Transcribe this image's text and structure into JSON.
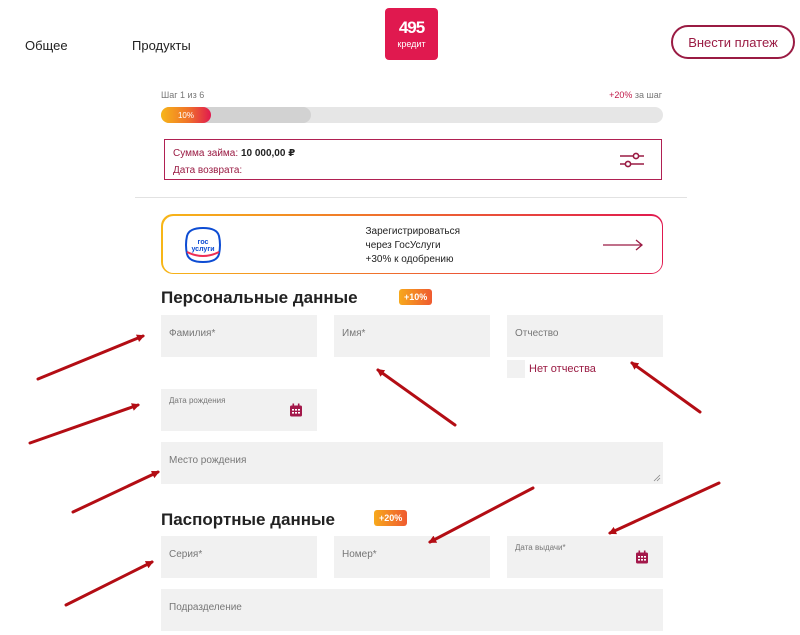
{
  "nav": {
    "general": "Общее",
    "products": "Продукты"
  },
  "logo": {
    "number": "495",
    "word": "кредит"
  },
  "header": {
    "pay_button": "Внести платеж"
  },
  "progress": {
    "step_label": "Шаг 1 из 6",
    "bonus_pct": "+20%",
    "bonus_suffix": " за шаг",
    "fill_label": "10%",
    "fill_fraction": 0.1
  },
  "summary": {
    "amount_label": "Сумма займа: ",
    "amount_value": "10 000,00 ₽",
    "return_label": "Дата возврата:"
  },
  "gosuslugi": {
    "logo_line1": "гос",
    "logo_line2": "услуги",
    "line1": "Зарегистрироваться",
    "line2": "через ГосУслуги",
    "line3": "+30% к одобрению"
  },
  "personal": {
    "title": "Персональные данные",
    "badge": "+10%",
    "last_name": "Фамилия*",
    "first_name": "Имя*",
    "middle_name": "Отчество",
    "no_middle_name": "Нет отчества",
    "birth_date": "Дата рождения",
    "birth_place": "Место рождения"
  },
  "passport": {
    "title": "Паспортные данные",
    "badge": "+20%",
    "series": "Серия*",
    "number": "Номер*",
    "issue_date": "Дата выдачи*",
    "department": "Подразделение"
  },
  "colors": {
    "brand": "#e0194f",
    "accent_dark": "#9a1b43",
    "field_bg": "#f1f1f1",
    "annotation_arrow": "#b30d14"
  }
}
